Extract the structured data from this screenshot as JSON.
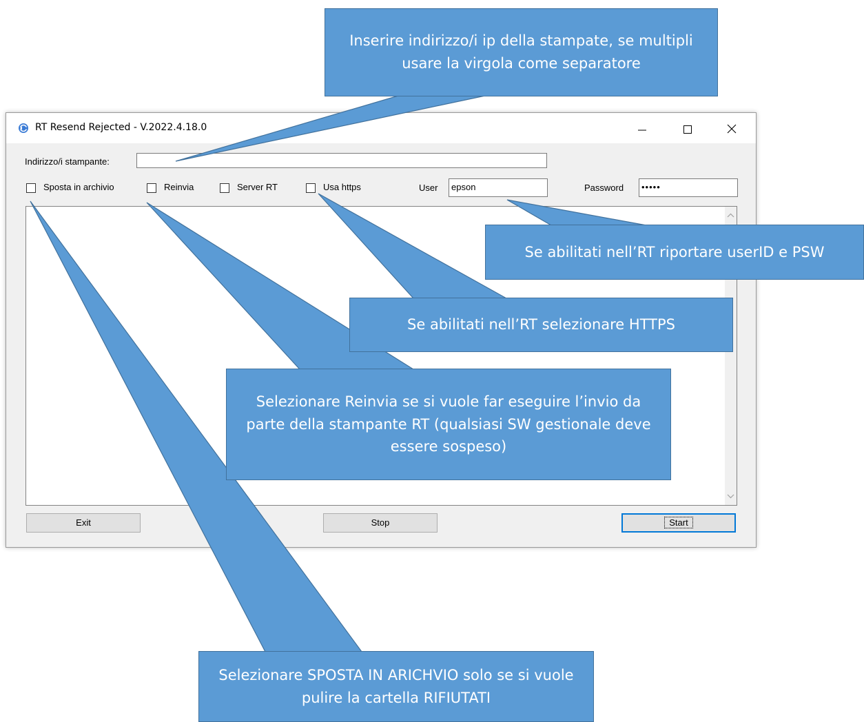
{
  "window": {
    "title": "RT Resend Rejected - V.2022.4.18.0",
    "icon": "app-refresh-icon"
  },
  "form": {
    "printer_address_label": "Indirizzo/i stampante:",
    "printer_address_value": "",
    "checkboxes": {
      "archive": {
        "label": "Sposta in archivio",
        "checked": false
      },
      "resend": {
        "label": "Reinvia",
        "checked": false
      },
      "server_rt": {
        "label": "Server RT",
        "checked": false
      },
      "https": {
        "label": "Usa https",
        "checked": false
      }
    },
    "user_label": "User",
    "user_value": "epson",
    "password_label": "Password",
    "password_value": "•••••"
  },
  "buttons": {
    "exit": "Exit",
    "stop": "Stop",
    "start": "Start"
  },
  "callouts": {
    "ip": "Inserire indirizzo/i ip della stampate, se multipli usare la virgola come separatore",
    "credentials": "Se abilitati nell’RT riportare userID e PSW",
    "https": "Se abilitati nell’RT selezionare HTTPS",
    "resend": "Selezionare Reinvia se si vuole far eseguire l’invio da parte della stampante RT (qualsiasi SW gestionale deve essere sospeso)",
    "archive": "Selezionare SPOSTA IN ARICHVIO solo se si vuole pulire la cartella RIFIUTATI"
  },
  "colors": {
    "callout_fill": "#5b9bd5",
    "callout_border": "#41719c",
    "default_button_border": "#0078d7"
  }
}
